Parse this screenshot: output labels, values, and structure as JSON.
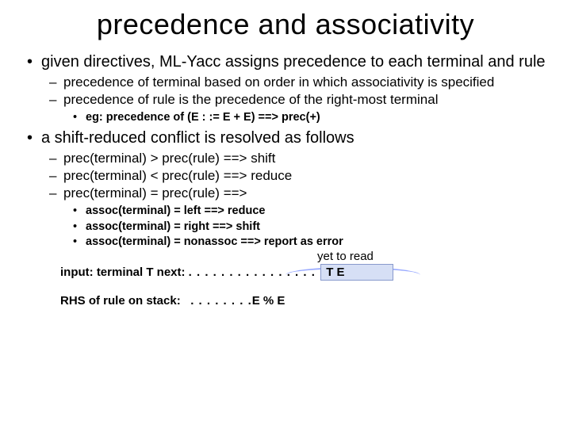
{
  "title": "precedence and associativity",
  "bullets": {
    "b1": "given directives, ML-Yacc assigns precedence to each terminal and rule",
    "b1s1": "precedence of terminal based on order in which associativity is specified",
    "b1s2": "precedence of rule is the precedence of the right-most terminal",
    "b1s2e": "eg: precedence of (E : := E + E) ==> prec(+)",
    "b2": "a shift-reduced conflict is resolved as follows",
    "b2s1": "prec(terminal) > prec(rule) ==> shift",
    "b2s2": "prec(terminal) < prec(rule) ==> reduce",
    "b2s3": "prec(terminal) = prec(rule) ==>",
    "b2s3a": "assoc(terminal) = left ==> reduce",
    "b2s3b": "assoc(terminal) = right ==> shift",
    "b2s3c": "assoc(terminal) = nonassoc ==> report as error"
  },
  "diagram": {
    "yet_to_read": "yet to read",
    "input_label": "input: terminal T next:",
    "input_dots": ". . . . . . . . . . . . . . . . .",
    "input_te": "T E",
    "rhs_label": "RHS of rule on stack:",
    "rhs_dots": ". . . . . . . .",
    "rhs_val": "E % E"
  }
}
